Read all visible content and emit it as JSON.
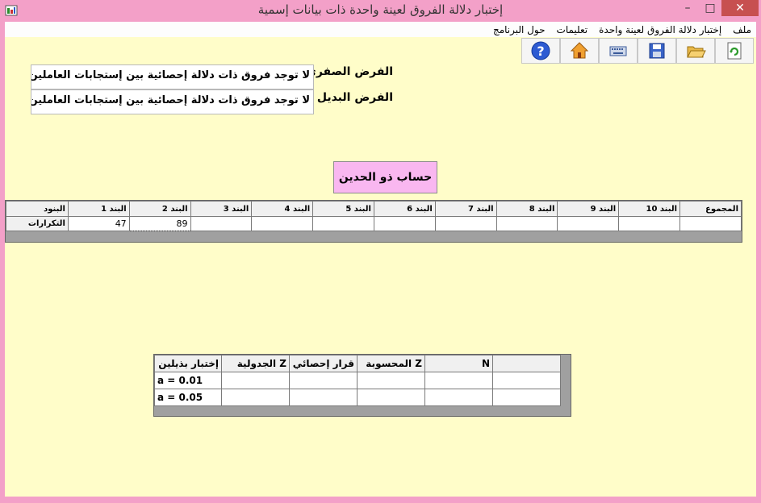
{
  "window": {
    "title": "إختبار دلالة الفروق لعينة واحدة ذات بيانات إسمية",
    "minimize": "–",
    "maximize": "□",
    "close": "✕"
  },
  "menu": {
    "items": [
      "ملف",
      "إختبار دلالة الفروق لعينة واحدة",
      "تعليمات",
      "حول البرنامج"
    ]
  },
  "toolbar": {
    "buttons": [
      {
        "name": "refresh",
        "icon": "refresh-icon"
      },
      {
        "name": "open",
        "icon": "folder-icon"
      },
      {
        "name": "save",
        "icon": "save-icon"
      },
      {
        "name": "keyboard",
        "icon": "keyboard-icon"
      },
      {
        "name": "home",
        "icon": "home-icon"
      },
      {
        "name": "help",
        "icon": "help-icon"
      }
    ]
  },
  "hypothesis": {
    "null_label": "الفرض الصفري",
    "null_value": "لا توجد فروق ذات دلالة إحصائية بين إستجابات العاملين حول رأيهم",
    "alt_label": "الفرض البديل",
    "alt_value": "لا توجد فروق ذات دلالة إحصائية بين إستجابات العاملين حول رأيهم"
  },
  "calc_button": "حساب ذو الحدين",
  "freq_grid": {
    "headers": [
      "البنود",
      "البند 1",
      "البند 2",
      "البند 3",
      "البند 4",
      "البند 5",
      "البند 6",
      "البند 7",
      "البند 8",
      "البند 9",
      "البند 10",
      "المجموع"
    ],
    "row_label": "التكرارات",
    "values": [
      "47",
      "89",
      "",
      "",
      "",
      "",
      "",
      "",
      "",
      "",
      ""
    ]
  },
  "result_grid": {
    "headers": [
      "إختبار بذيلين",
      "Z الجدولية",
      "قرار إحصائي",
      "Z المحسوبة",
      "N",
      ""
    ],
    "rows": [
      {
        "label": "a = 0.01",
        "cells": [
          "",
          "",
          "",
          "",
          ""
        ]
      },
      {
        "label": "a = 0.05",
        "cells": [
          "",
          "",
          "",
          "",
          ""
        ]
      }
    ]
  }
}
